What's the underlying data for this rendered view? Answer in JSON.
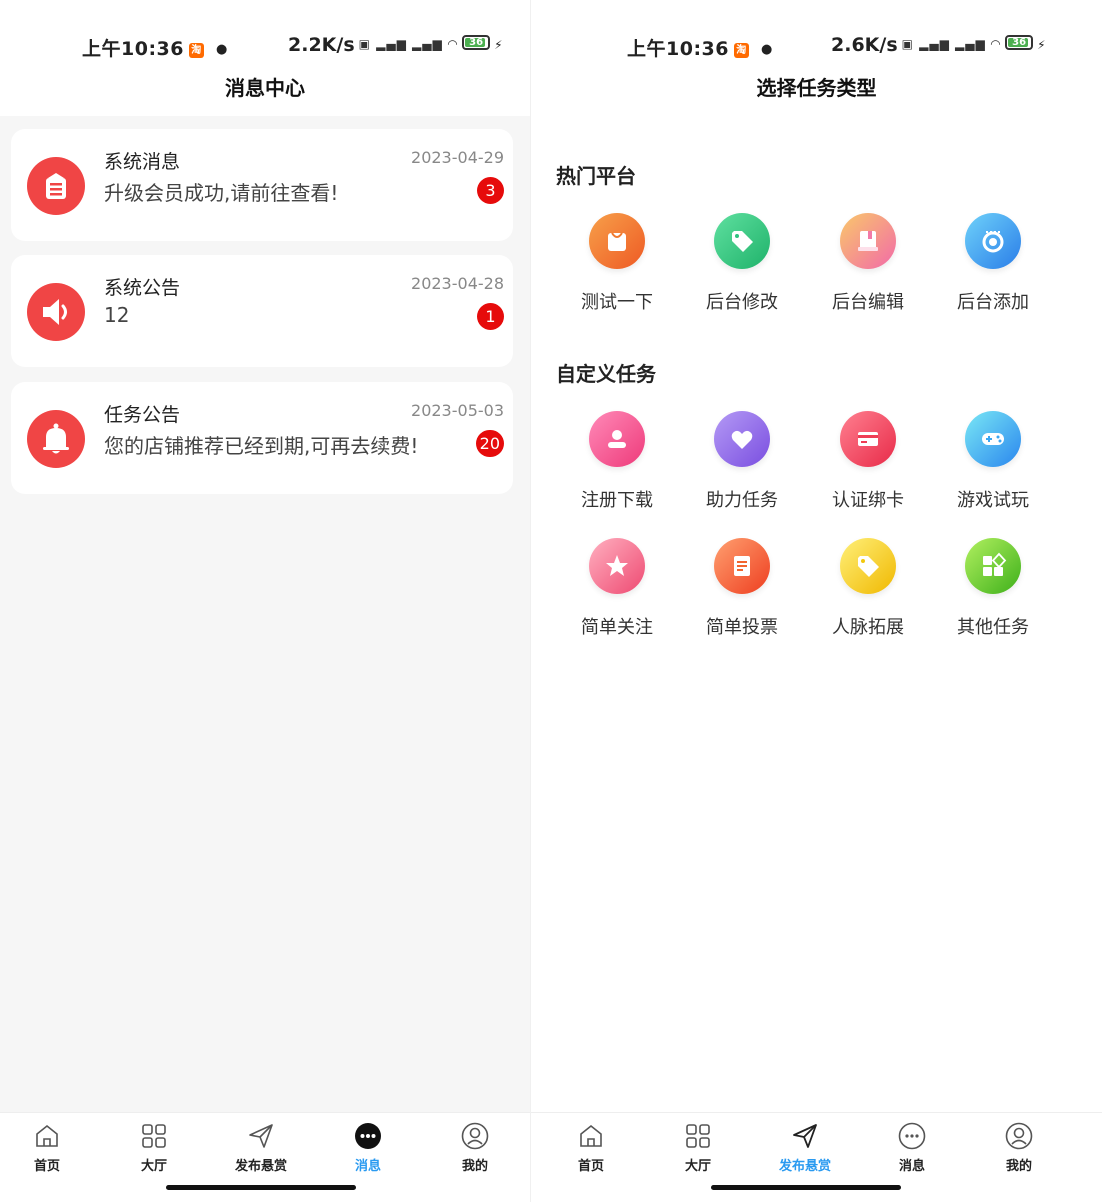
{
  "left": {
    "status": {
      "time": "上午10:36",
      "speed": "2.2K/s",
      "battery": "36"
    },
    "title": "消息中心",
    "messages": [
      {
        "title": "系统消息",
        "desc": "升级会员成功,请前往查看!",
        "date": "2023-04-29",
        "badge": "3",
        "icon": "document-icon"
      },
      {
        "title": "系统公告",
        "desc": "12",
        "date": "2023-04-28",
        "badge": "1",
        "icon": "speaker-icon"
      },
      {
        "title": "任务公告",
        "desc": "您的店铺推荐已经到期,可再去续费!",
        "date": "2023-05-03",
        "badge": "20",
        "icon": "bell-icon"
      }
    ]
  },
  "right": {
    "status": {
      "time": "上午10:36",
      "speed": "2.6K/s",
      "battery": "36"
    },
    "title": "选择任务类型",
    "hot_section": "热门平台",
    "hot_items": [
      {
        "label": "测试一下",
        "icon": "shopping-bag-icon",
        "color": "#f2762e"
      },
      {
        "label": "后台修改",
        "icon": "tag-icon",
        "color": "#2ec27e"
      },
      {
        "label": "后台编辑",
        "icon": "book-icon",
        "color": "#f27aa8"
      },
      {
        "label": "后台添加",
        "icon": "camera-lens-icon",
        "color": "#3a9af0"
      }
    ],
    "custom_section": "自定义任务",
    "custom_items": [
      {
        "label": "注册下载",
        "icon": "user-icon",
        "color": "#f0508a"
      },
      {
        "label": "助力任务",
        "icon": "heart-icon",
        "color": "#8a63e8"
      },
      {
        "label": "认证绑卡",
        "icon": "card-icon",
        "color": "#ef3d55"
      },
      {
        "label": "游戏试玩",
        "icon": "gamepad-icon",
        "color": "#3aa6f2"
      },
      {
        "label": "简单关注",
        "icon": "star-icon",
        "color": "#f26d8c"
      },
      {
        "label": "简单投票",
        "icon": "ballot-icon",
        "color": "#f2652e"
      },
      {
        "label": "人脉拓展",
        "icon": "tag-icon",
        "color": "#f2c80e"
      },
      {
        "label": "其他任务",
        "icon": "apps-icon",
        "color": "#6bc92a"
      }
    ]
  },
  "tabs": [
    "首页",
    "大厅",
    "发布悬赏",
    "消息",
    "我的"
  ],
  "colors": {
    "accent": "#2a9af0",
    "badge": "#e60b0b",
    "message_icon": "#f04545"
  }
}
